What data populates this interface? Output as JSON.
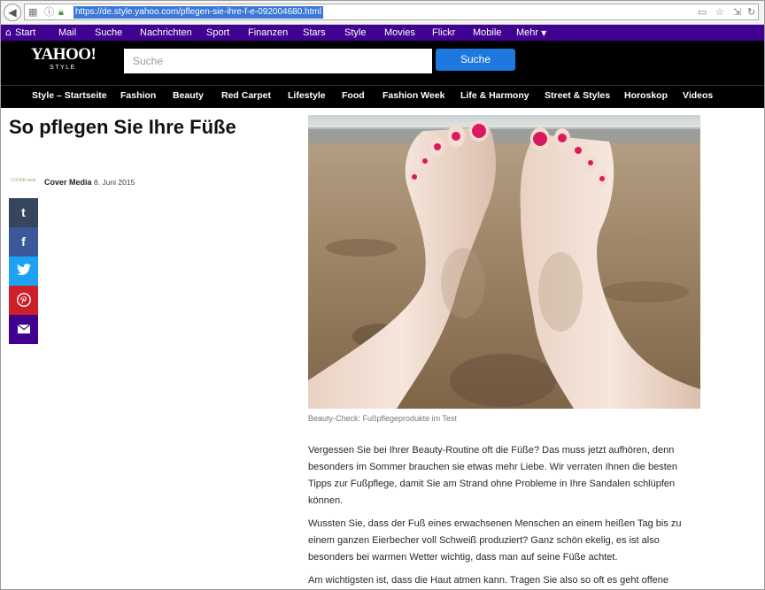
{
  "browser": {
    "url": "https://de.style.yahoo.com/pflegen-sie-ihre-f-e-092004680.html"
  },
  "top_nav": {
    "items": [
      "Start",
      "Mail",
      "Suche",
      "Nachrichten",
      "Sport",
      "Finanzen",
      "Stars",
      "Style",
      "Movies",
      "Flickr",
      "Mobile",
      "Mehr"
    ]
  },
  "header": {
    "logo_text": "YAHOO!",
    "logo_sub": "STYLE",
    "search_placeholder": "Suche",
    "search_button": "Suche"
  },
  "section_nav": {
    "items": [
      "Style – Startseite",
      "Fashion",
      "Beauty",
      "Red Carpet",
      "Lifestyle",
      "Food",
      "Fashion Week",
      "Life & Harmony",
      "Street & Styles",
      "Horoskop",
      "Videos"
    ]
  },
  "article": {
    "title": "So pflegen Sie Ihre Füße",
    "author_logo": "COVER media",
    "author": "Cover Media",
    "date": "8. Juni 2015",
    "image_caption": "Beauty-Check: Fußpflegeprodukte im Test",
    "paragraphs": [
      "Vergessen Sie bei Ihrer Beauty-Routine oft die Füße? Das muss jetzt aufhören, denn besonders im Sommer brauchen sie etwas mehr Liebe. Wir verraten Ihnen die besten Tipps zur Fußpflege, damit Sie am Strand ohne Probleme in Ihre Sandalen schlüpfen können.",
      "Wussten Sie, dass der Fuß eines erwachsenen Menschen an einem heißen Tag bis zu einem ganzen Eierbecher voll Schweiß produziert? Ganz schön ekelig, es ist also besonders bei warmen Wetter wichtig, dass man auf seine Füße achtet.",
      "Am wichtigsten ist, dass die Haut atmen kann. Tragen Sie also so oft es geht offene"
    ]
  },
  "share": {
    "items": [
      {
        "name": "tumblr",
        "glyph": "t",
        "color": "#36465d"
      },
      {
        "name": "facebook",
        "glyph": "f",
        "color": "#3b5998"
      },
      {
        "name": "twitter",
        "glyph": "twitter-bird",
        "color": "#1da1f2"
      },
      {
        "name": "pinterest",
        "glyph": "pinterest-p",
        "color": "#cb2027"
      },
      {
        "name": "mail",
        "glyph": "envelope",
        "color": "#400090"
      }
    ]
  },
  "colors": {
    "yahoo_purple": "#400090",
    "search_blue": "#1d78e0",
    "header_black": "#000000"
  }
}
